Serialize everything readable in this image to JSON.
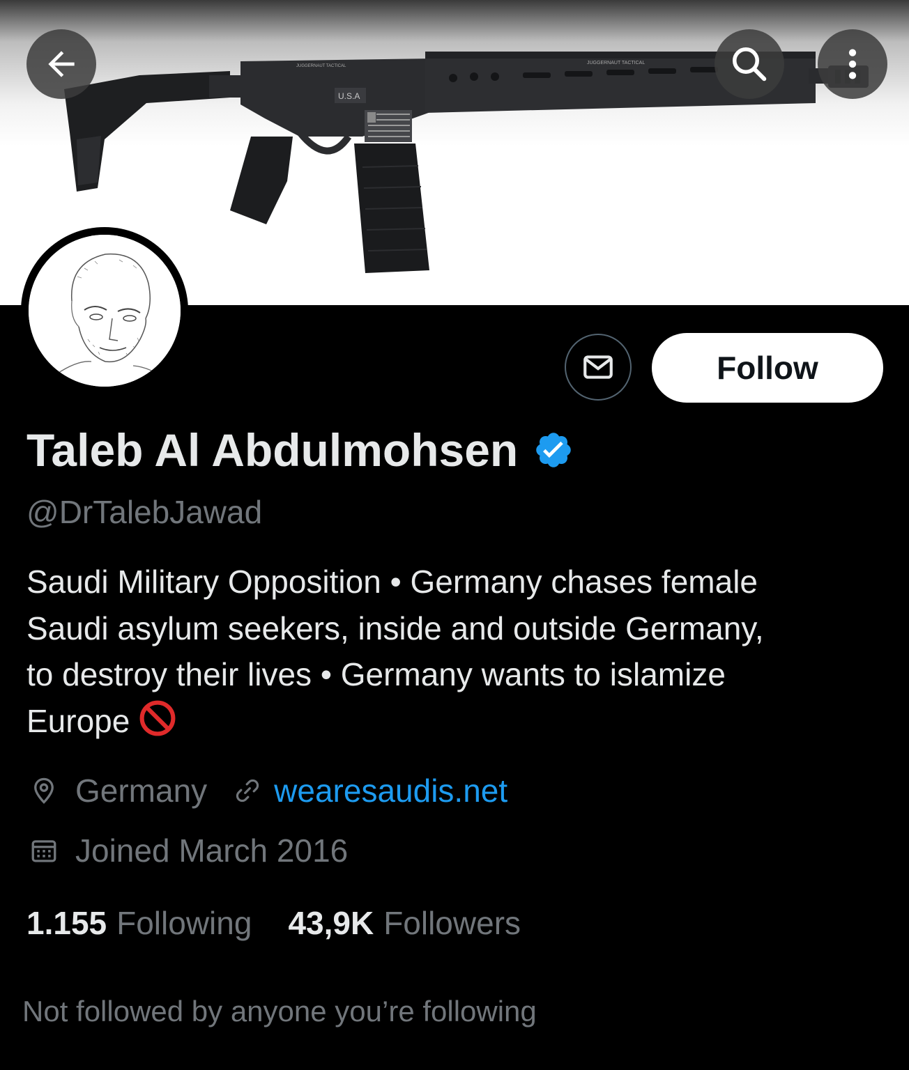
{
  "header": {
    "back_icon": "arrow-left-icon",
    "search_icon": "search-icon",
    "more_icon": "more-vertical-icon",
    "banner_text": {
      "usa_label": "U.S.A",
      "brand_left": "JUGGERNAUT TACTICAL",
      "brand_right": "JUGGERNAUT TACTICAL"
    }
  },
  "profile": {
    "display_name": "Taleb Al Abdulmohsen",
    "verified": true,
    "handle": "@DrTalebJawad",
    "bio": {
      "line1": "Saudi Military Opposition • Germany chases female",
      "line2": "Saudi asylum seekers, inside and outside Germany,",
      "line3": "to destroy their lives • Germany wants to islamize",
      "line4": "Europe"
    },
    "location": "Germany",
    "url": "wearesaudis.net",
    "joined": "Joined March 2016"
  },
  "actions": {
    "message_icon": "envelope-icon",
    "follow_label": "Follow"
  },
  "stats": {
    "following_count": "1.155",
    "following_label": "Following",
    "followers_count": "43,9K",
    "followers_label": "Followers"
  },
  "footer": {
    "not_followed_text": "Not followed by anyone you’re following"
  },
  "colors": {
    "background": "#000000",
    "text_primary": "#e7e9ea",
    "text_secondary": "#71767b",
    "link": "#1d9bf0",
    "verified_badge": "#1d9bf0",
    "follow_button_bg": "#ffffff",
    "prohibited_emoji": "#e02a2a"
  }
}
